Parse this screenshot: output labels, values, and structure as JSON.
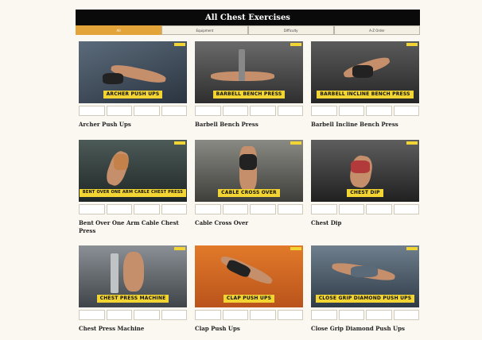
{
  "header": {
    "title": "All Chest Exercises"
  },
  "tabs": [
    {
      "label": "All",
      "active": true
    },
    {
      "label": "Equipment",
      "active": false
    },
    {
      "label": "Difficulty",
      "active": false
    },
    {
      "label": "A-Z Order",
      "active": false
    }
  ],
  "exercises": [
    {
      "title": "Archer Push Ups",
      "banner": "ARCHER PUSH UPS",
      "bg": "#3b4a5a"
    },
    {
      "title": "Barbell Bench Press",
      "banner": "BARBELL BENCH PRESS",
      "bg": "#4a4a4a"
    },
    {
      "title": "Barbell Incline Bench Press",
      "banner": "BARBELL INCLINE BENCH PRESS",
      "bg": "#3a3a3a"
    },
    {
      "title": "Bent Over One Arm Cable Chest Press",
      "banner": "BENT OVER ONE ARM CABLE CHEST PRESS",
      "bg": "#2f3b3a"
    },
    {
      "title": "Cable Cross Over",
      "banner": "CABLE CROSS OVER",
      "bg": "#5a5a55"
    },
    {
      "title": "Chest Dip",
      "banner": "CHEST DIP",
      "bg": "#3e3e3e"
    },
    {
      "title": "Chest Press Machine",
      "banner": "CHEST PRESS MACHINE",
      "bg": "#555a5f"
    },
    {
      "title": "Clap Push Ups",
      "banner": "CLAP PUSH UPS",
      "bg": "#d9691f"
    },
    {
      "title": "Close Grip Diamond Push Ups",
      "banner": "CLOSE GRIP DIAMOND PUSH UPS",
      "bg": "#3f4f5f"
    }
  ],
  "colors": {
    "accent": "#e3a43a",
    "banner": "#f2d532",
    "header_bg": "#0a0a0a"
  }
}
